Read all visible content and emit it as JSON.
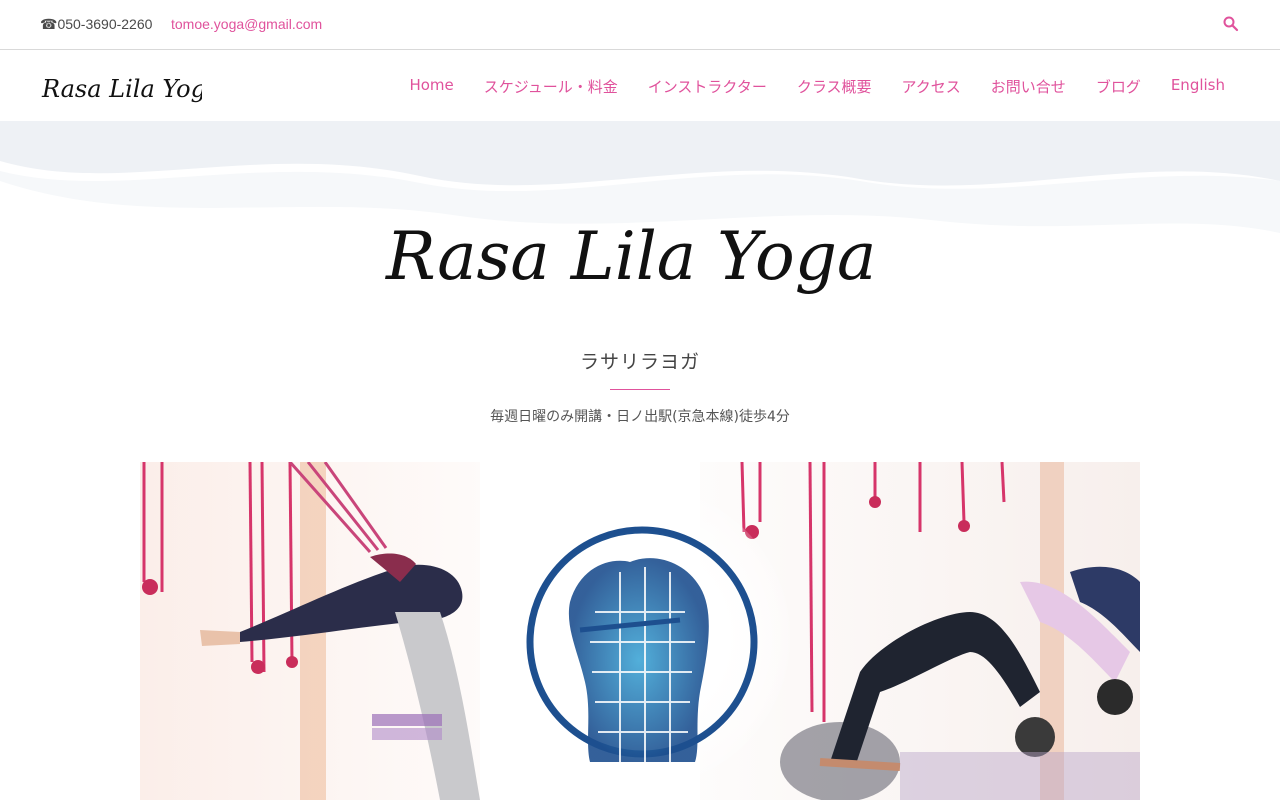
{
  "topbar": {
    "phone": "☎050-3690-2260",
    "email": "tomoe.yoga@gmail.com",
    "search_icon": "search-icon"
  },
  "header": {
    "logo_text": "Rasa Lila Yoga"
  },
  "nav": {
    "items": [
      {
        "label": "Home"
      },
      {
        "label": "スケジュール・料金"
      },
      {
        "label": "インストラクター"
      },
      {
        "label": "クラス概要"
      },
      {
        "label": "アクセス"
      },
      {
        "label": "お問い合せ"
      },
      {
        "label": "ブログ"
      },
      {
        "label": "English"
      }
    ]
  },
  "hero": {
    "logo_text": "Rasa Lila Yoga",
    "subtitle": "ラサリラヨガ",
    "tagline": "毎週日曜のみ開講・日ノ出駅(京急本線)徒歩4分"
  },
  "colors": {
    "accent": "#e0529c",
    "wave": "#eef1f5"
  }
}
